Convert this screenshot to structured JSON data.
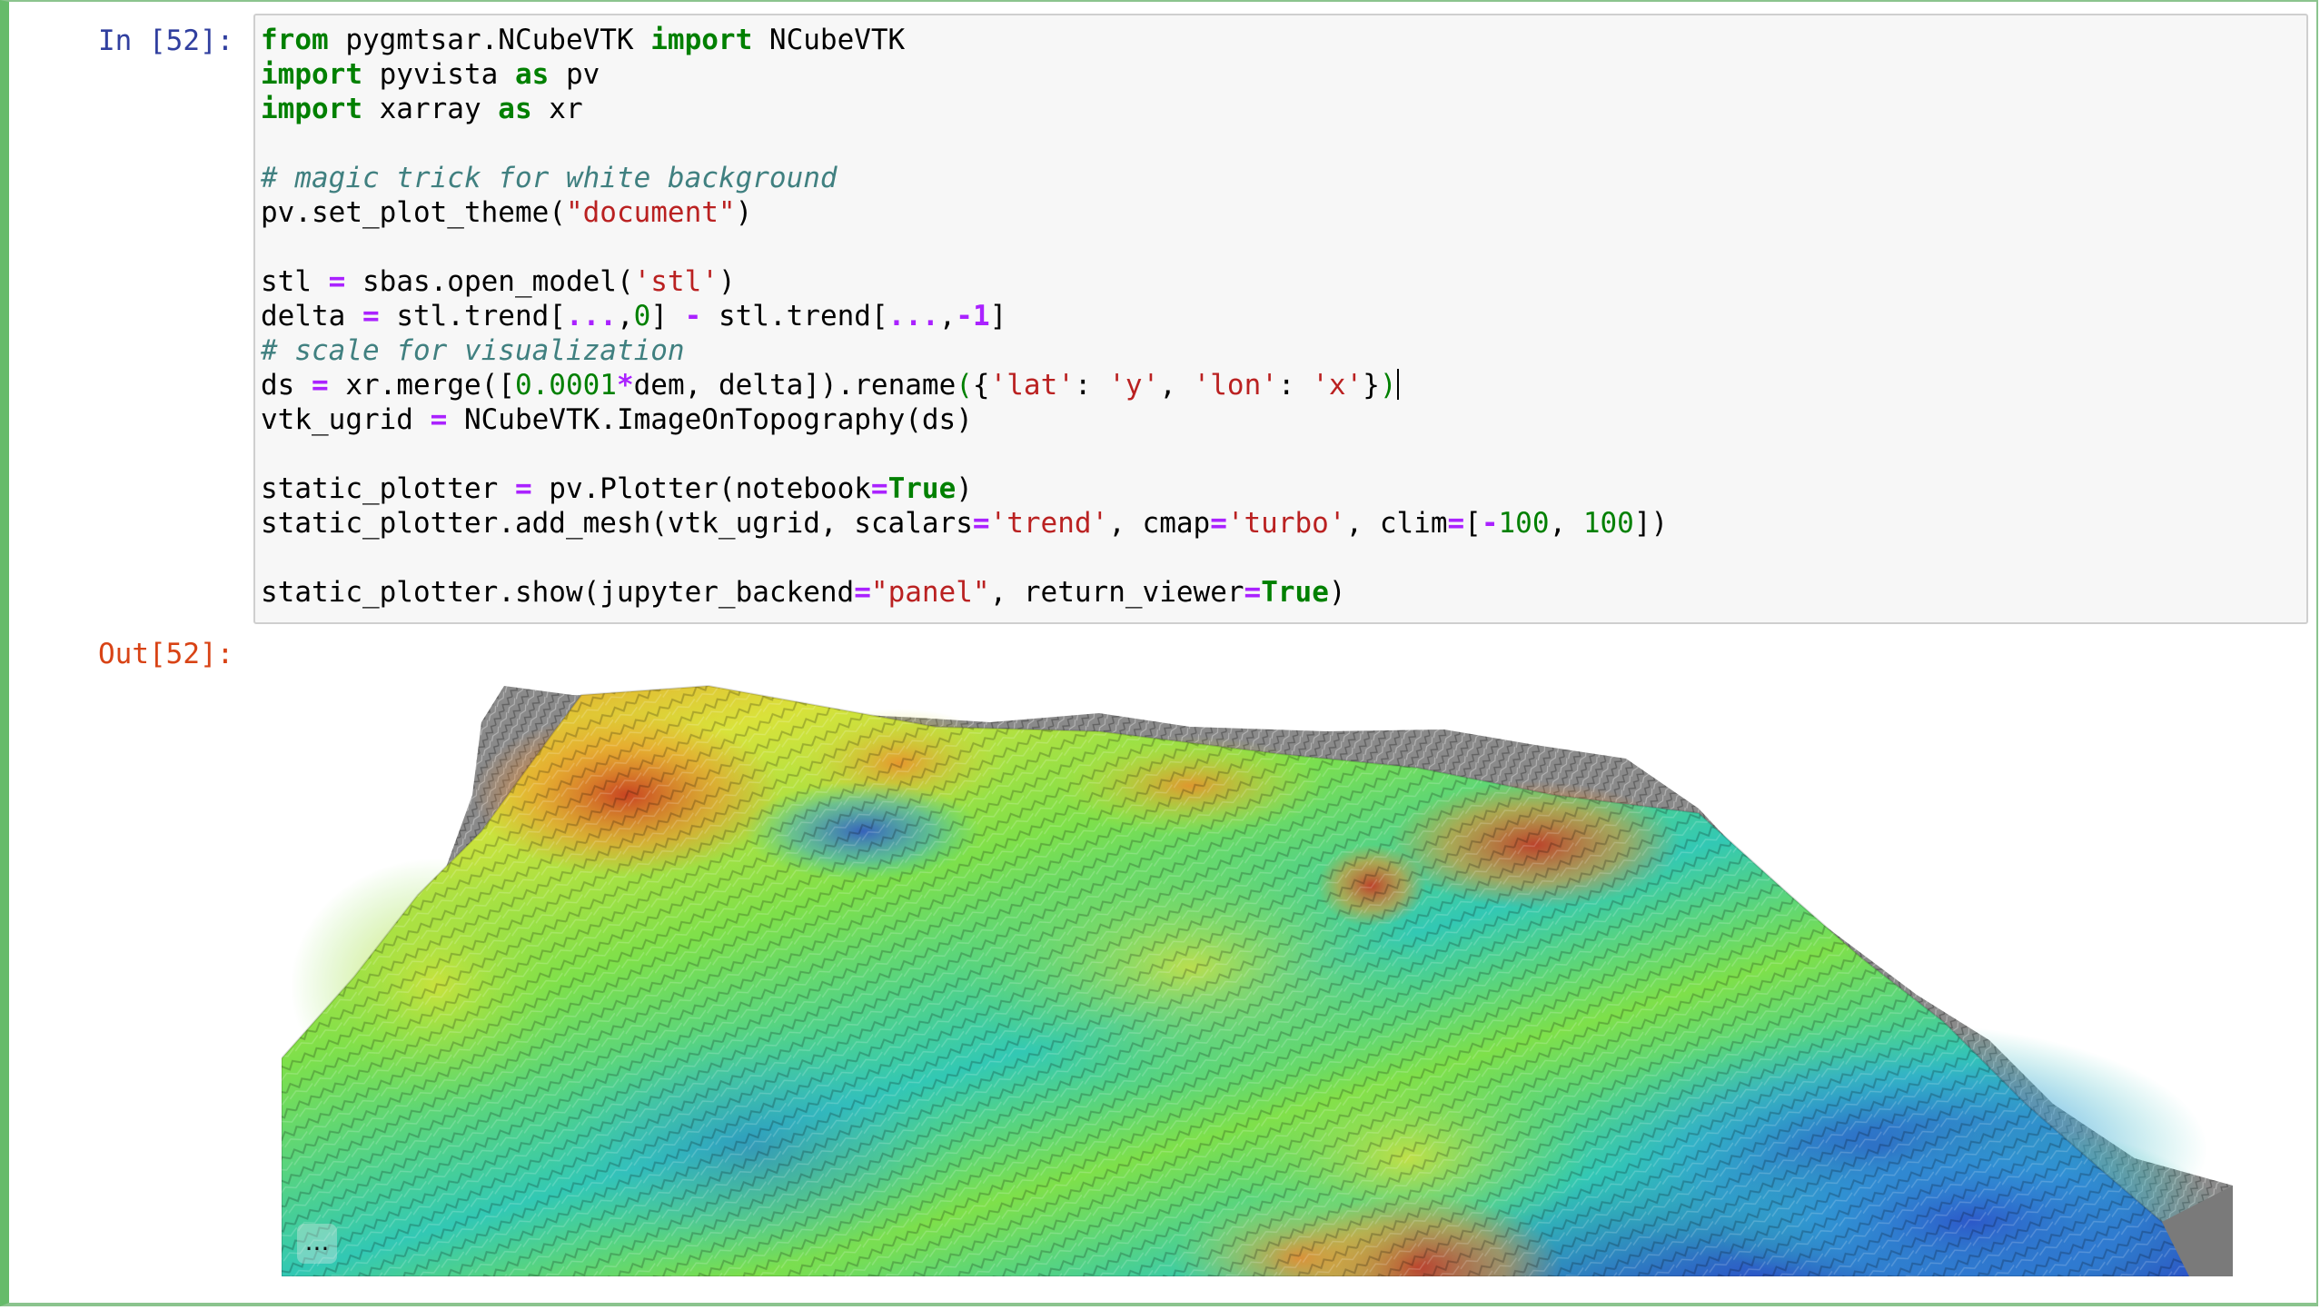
{
  "cell": {
    "input_prompt": "In [52]:",
    "output_prompt": "Out[52]:",
    "code_lines": [
      [
        {
          "t": "from",
          "c": "kw"
        },
        {
          "t": " pygmtsar.NCubeVTK "
        },
        {
          "t": "import",
          "c": "kw"
        },
        {
          "t": " NCubeVTK"
        }
      ],
      [
        {
          "t": "import",
          "c": "kw"
        },
        {
          "t": " pyvista "
        },
        {
          "t": "as",
          "c": "kw"
        },
        {
          "t": " pv"
        }
      ],
      [
        {
          "t": "import",
          "c": "kw"
        },
        {
          "t": " xarray "
        },
        {
          "t": "as",
          "c": "kw"
        },
        {
          "t": " xr"
        }
      ],
      [],
      [
        {
          "t": "# magic trick for white background",
          "c": "cm"
        }
      ],
      [
        {
          "t": "pv.set_plot_theme("
        },
        {
          "t": "\"document\"",
          "c": "st"
        },
        {
          "t": ")"
        }
      ],
      [],
      [
        {
          "t": "stl "
        },
        {
          "t": "=",
          "c": "op"
        },
        {
          "t": " sbas.open_model("
        },
        {
          "t": "'stl'",
          "c": "st"
        },
        {
          "t": ")"
        }
      ],
      [
        {
          "t": "delta "
        },
        {
          "t": "=",
          "c": "op"
        },
        {
          "t": " stl.trend["
        },
        {
          "t": "...",
          "c": "op"
        },
        {
          "t": ","
        },
        {
          "t": "0",
          "c": "nm"
        },
        {
          "t": "] "
        },
        {
          "t": "-",
          "c": "op"
        },
        {
          "t": " stl.trend["
        },
        {
          "t": "...",
          "c": "op"
        },
        {
          "t": ","
        },
        {
          "t": "-1",
          "c": "op"
        },
        {
          "t": "]"
        }
      ],
      [
        {
          "t": "# scale for visualization",
          "c": "cm"
        }
      ],
      [
        {
          "t": "ds "
        },
        {
          "t": "=",
          "c": "op"
        },
        {
          "t": " xr.merge(["
        },
        {
          "t": "0.0001",
          "c": "nm"
        },
        {
          "t": "*",
          "c": "op"
        },
        {
          "t": "dem, delta]).rename"
        },
        {
          "t": "(",
          "c": "nm"
        },
        {
          "t": "{"
        },
        {
          "t": "'lat'",
          "c": "st"
        },
        {
          "t": ": "
        },
        {
          "t": "'y'",
          "c": "st"
        },
        {
          "t": ", "
        },
        {
          "t": "'lon'",
          "c": "st"
        },
        {
          "t": ": "
        },
        {
          "t": "'x'",
          "c": "st"
        },
        {
          "t": "}"
        },
        {
          "t": ")",
          "c": "nm"
        },
        {
          "t": "",
          "c": "caret"
        }
      ],
      [
        {
          "t": "vtk_ugrid "
        },
        {
          "t": "=",
          "c": "op"
        },
        {
          "t": " NCubeVTK.ImageOnTopography(ds)"
        }
      ],
      [],
      [
        {
          "t": "static_plotter "
        },
        {
          "t": "=",
          "c": "op"
        },
        {
          "t": " pv.Plotter(notebook"
        },
        {
          "t": "=",
          "c": "op"
        },
        {
          "t": "True",
          "c": "kw"
        },
        {
          "t": ")"
        }
      ],
      [
        {
          "t": "static_plotter.add_mesh(vtk_ugrid, scalars"
        },
        {
          "t": "=",
          "c": "op"
        },
        {
          "t": "'trend'",
          "c": "st"
        },
        {
          "t": ", cmap"
        },
        {
          "t": "=",
          "c": "op"
        },
        {
          "t": "'turbo'",
          "c": "st"
        },
        {
          "t": ", clim"
        },
        {
          "t": "=",
          "c": "op"
        },
        {
          "t": "["
        },
        {
          "t": "-",
          "c": "op"
        },
        {
          "t": "100",
          "c": "nm"
        },
        {
          "t": ", "
        },
        {
          "t": "100",
          "c": "nm"
        },
        {
          "t": "])"
        }
      ],
      [],
      [
        {
          "t": "static_plotter.show(jupyter_backend"
        },
        {
          "t": "=",
          "c": "op"
        },
        {
          "t": "\"panel\"",
          "c": "st"
        },
        {
          "t": ", return_viewer"
        },
        {
          "t": "=",
          "c": "op"
        },
        {
          "t": "True",
          "c": "kw"
        },
        {
          "t": ")"
        }
      ]
    ]
  },
  "output": {
    "viewer_menu_label": "...",
    "colormap": "turbo",
    "colors": {
      "terrain_gray": "#8a8a8a",
      "turbo_blue": "#2c55c8",
      "turbo_cyan": "#32c8b4",
      "turbo_green": "#7ee04a",
      "turbo_yellow": "#d9e23a",
      "turbo_orange": "#ef8a2a",
      "turbo_red": "#c8321e"
    }
  }
}
